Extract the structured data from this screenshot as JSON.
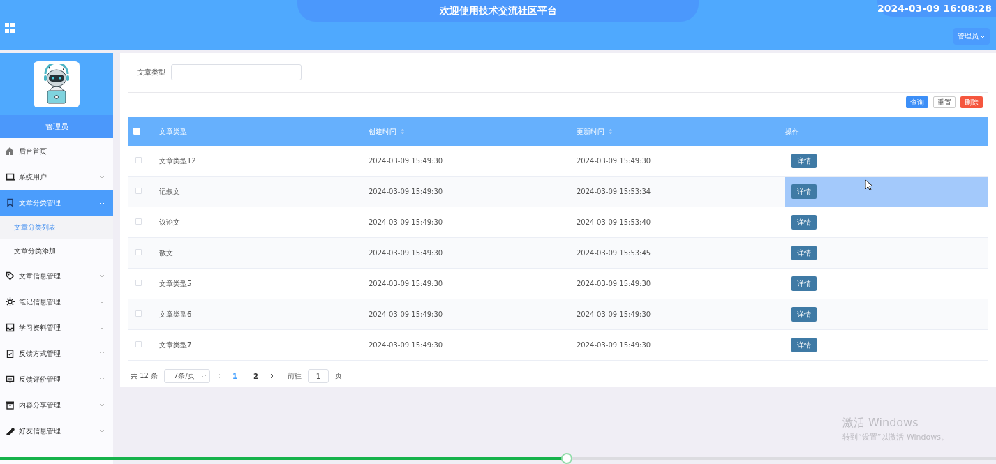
{
  "header": {
    "title": "欢迎使用技术交流社区平台",
    "clock": "2024-03-09 16:08:28",
    "user_menu": "管理员"
  },
  "sidebar": {
    "profile_name": "管理员",
    "items": [
      {
        "label": "后台首页",
        "has_submenu": false,
        "selected": false
      },
      {
        "label": "系统用户",
        "has_submenu": true,
        "expanded": false,
        "selected": false
      },
      {
        "label": "文章分类管理",
        "has_submenu": true,
        "expanded": true,
        "selected": true,
        "children": [
          {
            "label": "文章分类列表",
            "selected": true
          },
          {
            "label": "文章分类添加",
            "selected": false
          }
        ]
      },
      {
        "label": "文章信息管理",
        "has_submenu": true,
        "expanded": false,
        "selected": false
      },
      {
        "label": "笔记信息管理",
        "has_submenu": true,
        "expanded": false,
        "selected": false
      },
      {
        "label": "学习资料管理",
        "has_submenu": true,
        "expanded": false,
        "selected": false
      },
      {
        "label": "反馈方式管理",
        "has_submenu": true,
        "expanded": false,
        "selected": false
      },
      {
        "label": "反馈评价管理",
        "has_submenu": true,
        "expanded": false,
        "selected": false
      },
      {
        "label": "内容分享管理",
        "has_submenu": true,
        "expanded": false,
        "selected": false
      },
      {
        "label": "好友信息管理",
        "has_submenu": true,
        "expanded": false,
        "selected": false
      }
    ]
  },
  "search": {
    "label": "文章类型"
  },
  "actions": [
    {
      "label": "查询",
      "kind": "primary"
    },
    {
      "label": "重置",
      "kind": "plain"
    },
    {
      "label": "删除",
      "kind": "danger"
    }
  ],
  "table": {
    "header_checked": false,
    "columns": [
      {
        "label": "文章类型",
        "sortable": false
      },
      {
        "label": "创建时间",
        "sortable": true
      },
      {
        "label": "更新时间",
        "sortable": true
      },
      {
        "label": "操作",
        "sortable": false
      }
    ],
    "rows": [
      {
        "checked": false,
        "hovered": false,
        "cells": [
          "文章类型12",
          "2024-03-09 15:49:30",
          "2024-03-09 15:49:30"
        ],
        "action": "详情"
      },
      {
        "checked": false,
        "hovered": true,
        "cells": [
          "记叙文",
          "2024-03-09 15:49:30",
          "2024-03-09 15:53:34"
        ],
        "action": "详情"
      },
      {
        "checked": false,
        "hovered": false,
        "cells": [
          "议论文",
          "2024-03-09 15:49:30",
          "2024-03-09 15:53:40"
        ],
        "action": "详情"
      },
      {
        "checked": false,
        "hovered": false,
        "cells": [
          "散文",
          "2024-03-09 15:49:30",
          "2024-03-09 15:53:45"
        ],
        "action": "详情"
      },
      {
        "checked": false,
        "hovered": false,
        "cells": [
          "文章类型5",
          "2024-03-09 15:49:30",
          "2024-03-09 15:49:30"
        ],
        "action": "详情"
      },
      {
        "checked": false,
        "hovered": false,
        "cells": [
          "文章类型6",
          "2024-03-09 15:49:30",
          "2024-03-09 15:49:30"
        ],
        "action": "详情"
      },
      {
        "checked": false,
        "hovered": false,
        "cells": [
          "文章类型7",
          "2024-03-09 15:49:30",
          "2024-03-09 15:49:30"
        ],
        "action": "详情"
      }
    ]
  },
  "pagination": {
    "total": "共 12 条",
    "page_size": "7条/页",
    "pages": [
      {
        "label": "1",
        "selected": true
      },
      {
        "label": "2",
        "selected": false
      }
    ],
    "goto_label": "前往",
    "goto_value": "1",
    "goto_suffix": "页"
  },
  "os_notice": {
    "title": "激活 Windows",
    "subtitle": "转到“设置”以激活 Windows。"
  },
  "player": {
    "level": 0.57
  }
}
